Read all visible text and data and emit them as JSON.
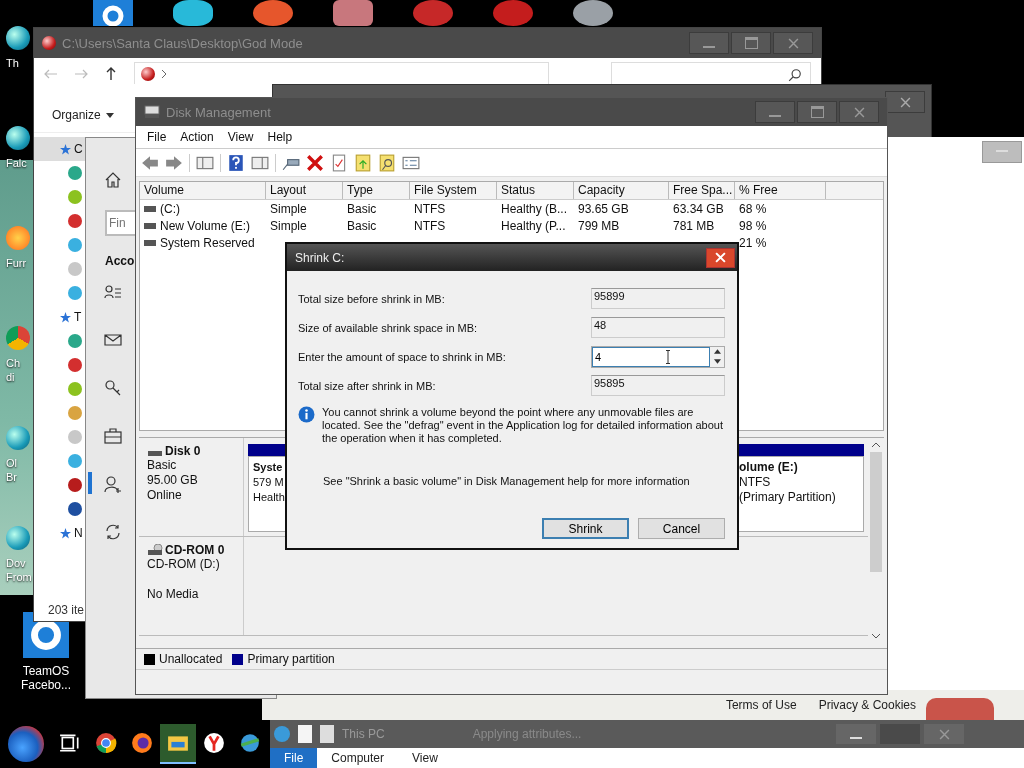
{
  "desktop_icons": [
    {
      "label": "Th",
      "kind": "ornament"
    },
    {
      "label": "Falc",
      "kind": "ornament"
    },
    {
      "label": "Furr",
      "kind": "firefox"
    },
    {
      "label": "Ch\ndi",
      "kind": "chrome"
    },
    {
      "label": "Ol\nBr",
      "kind": "ornament"
    },
    {
      "label": "Dov\nFrom",
      "kind": "ornament"
    },
    {
      "label": "TeamOS\nFacebo...",
      "kind": "gear"
    }
  ],
  "explorer": {
    "title": "C:\\Users\\Santa Claus\\Desktop\\God Mode",
    "organize": "Organize",
    "nav_items": [
      {
        "label": "C",
        "selected": true,
        "children": [
          {
            "color": "#2aa88a"
          },
          {
            "color": "#8cc21f"
          },
          {
            "color": "#d32f2f"
          },
          {
            "color": "#3ab0e0"
          },
          {
            "color": "#c8c8c8"
          },
          {
            "color": "#3ab0e0"
          }
        ]
      },
      {
        "label": "T",
        "selected": false,
        "children": [
          {
            "color": "#2aa88a"
          },
          {
            "color": "#d32f2f"
          },
          {
            "color": "#8cc21f"
          },
          {
            "color": "#d9a441"
          },
          {
            "color": "#c8c8c8"
          },
          {
            "color": "#3ab0e0"
          },
          {
            "color": "#b71c1c"
          },
          {
            "color": "#1e4fa0"
          }
        ]
      },
      {
        "label": "N",
        "selected": false
      }
    ],
    "status": "203 ite"
  },
  "settings": {
    "search": {
      "placeholder": "Fin"
    },
    "heading": "Acco",
    "nav": [
      {
        "kind": "home",
        "selected": false
      },
      {
        "kind": "person-list",
        "selected": false
      },
      {
        "kind": "mail",
        "selected": false
      },
      {
        "kind": "key",
        "selected": false
      },
      {
        "kind": "briefcase",
        "selected": false
      },
      {
        "kind": "person-add",
        "selected": true
      },
      {
        "kind": "sync",
        "selected": false
      }
    ]
  },
  "back_window": {
    "footer_links": [
      "Terms of Use",
      "Privacy & Cookies"
    ]
  },
  "disk_management": {
    "title": "Disk Management",
    "menu": [
      "File",
      "Action",
      "View",
      "Help"
    ],
    "columns": [
      "Volume",
      "Layout",
      "Type",
      "File System",
      "Status",
      "Capacity",
      "Free Spa...",
      "% Free"
    ],
    "rows": [
      [
        "(C:)",
        "Simple",
        "Basic",
        "NTFS",
        "Healthy (B...",
        "93.65 GB",
        "63.34 GB",
        "68 %"
      ],
      [
        "New Volume (E:)",
        "Simple",
        "Basic",
        "NTFS",
        "Healthy (P...",
        "799 MB",
        "781 MB",
        "98 %"
      ],
      [
        "System Reserved",
        null,
        null,
        null,
        null,
        null,
        null,
        "21 %"
      ]
    ],
    "disks": [
      {
        "kind": "disk",
        "name": "Disk 0",
        "lines": [
          "Basic",
          "95.00 GB",
          "Online"
        ],
        "partitions": [
          [
            "Syste",
            "579 M",
            "Health"
          ],
          [
            "olume  (E:)",
            "NTFS",
            "(Primary Partition)"
          ]
        ]
      },
      {
        "kind": "cdrom",
        "name": "CD-ROM 0",
        "lines": [
          "CD-ROM (D:)",
          "No Media"
        ]
      }
    ],
    "legend": [
      {
        "label": "Unallocated",
        "color": "#000000"
      },
      {
        "label": "Primary partition",
        "color": "#00008b"
      }
    ]
  },
  "dialog": {
    "title": "Shrink C:",
    "fields": [
      {
        "label": "Total size before shrink in MB:",
        "value": "95899",
        "kind": "readonly"
      },
      {
        "label": "Size of available shrink space in MB:",
        "value": "48",
        "kind": "readonly"
      },
      {
        "label": "Enter the amount of space to shrink in MB:",
        "value": "4",
        "kind": "spin"
      },
      {
        "label": "Total size after shrink in MB:",
        "value": "95895",
        "kind": "readonly"
      }
    ],
    "info": "You cannot shrink a volume beyond the point where any unmovable files are located. See the \"defrag\" event in the Application log for detailed information about the operation when it has completed.",
    "help": "See \"Shrink a basic volume\" in Disk Management help for more information",
    "buttons": [
      {
        "label": "Shrink",
        "default": true
      },
      {
        "label": "Cancel",
        "default": false
      }
    ]
  },
  "taskbar": {
    "pinned": [
      {
        "kind": "taskview",
        "active": false
      },
      {
        "kind": "chrome",
        "active": false
      },
      {
        "kind": "firefox",
        "active": false
      },
      {
        "kind": "folder",
        "active": true
      },
      {
        "kind": "yandex",
        "active": false
      },
      {
        "kind": "globe",
        "active": false
      }
    ],
    "preview": {
      "title": "This PC",
      "task": "Applying attributes...",
      "ribbon_tabs": [
        {
          "label": "File",
          "selected": true
        },
        {
          "label": "Computer",
          "selected": false
        },
        {
          "label": "View",
          "selected": false
        }
      ]
    }
  }
}
